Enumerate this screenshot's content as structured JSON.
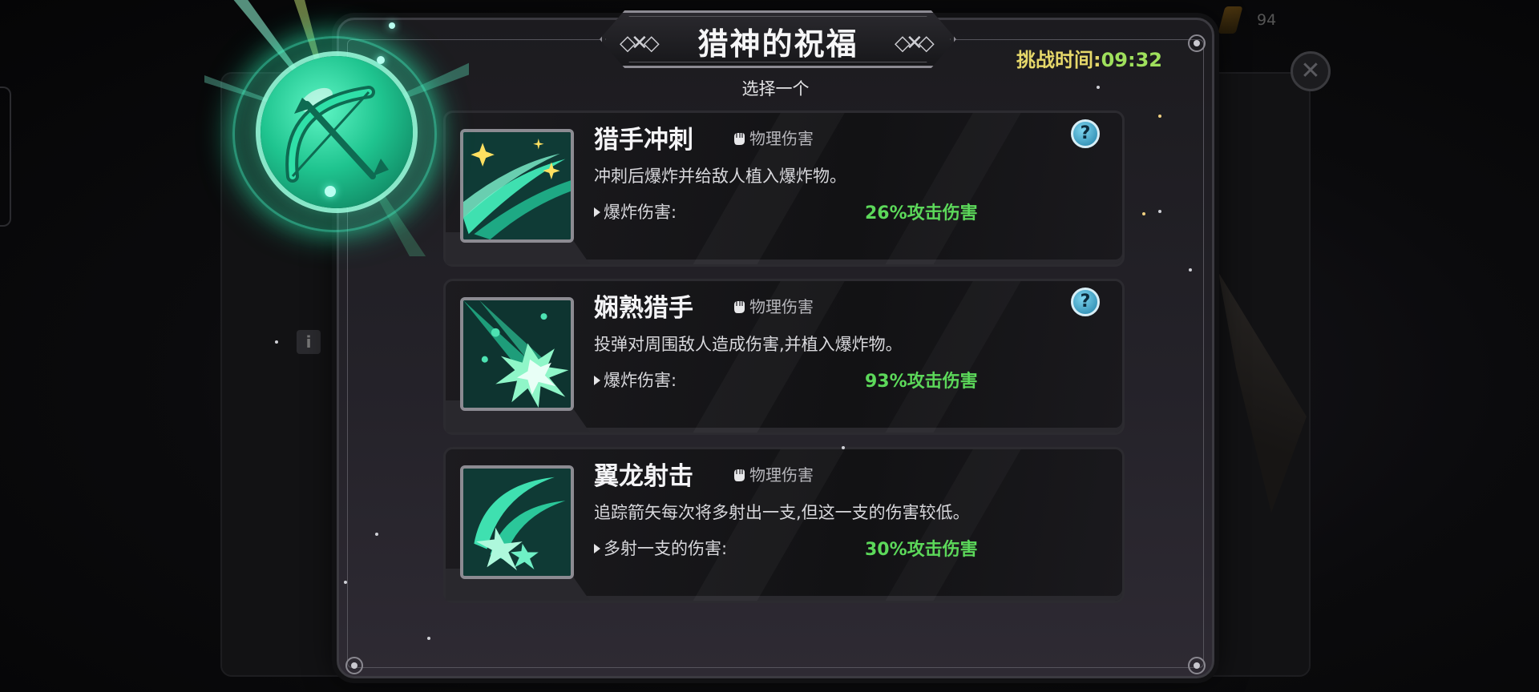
{
  "hud": {
    "counter": "94",
    "close_symbol": "✕",
    "info_symbol": "i"
  },
  "dialog": {
    "title": "猎神的祝福",
    "subtitle": "选择一个",
    "timer_label": "挑战时间:",
    "timer_value": "09:32"
  },
  "options": [
    {
      "name": "猎手冲刺",
      "damage_type": "物理伤害",
      "description": "冲刺后爆炸并给敌人植入爆炸物。",
      "stat_label": "爆炸伤害:",
      "stat_value": "26%攻击伤害",
      "icon": "dash-sparkle-icon",
      "help": "?"
    },
    {
      "name": "娴熟猎手",
      "damage_type": "物理伤害",
      "description": "投弹对周围敌人造成伤害,并植入爆炸物。",
      "stat_label": "爆炸伤害:",
      "stat_value": "93%攻击伤害",
      "icon": "burst-explosion-icon",
      "help": "?"
    },
    {
      "name": "翼龙射击",
      "damage_type": "物理伤害",
      "description": "追踪箭矢每次将多射出一支,但这一支的伤害较低。",
      "stat_label": "多射一支的伤害:",
      "stat_value": "30%攻击伤害",
      "icon": "curved-arrow-shot-icon"
    }
  ],
  "colors": {
    "accent_green": "#5cd85a",
    "timer_label": "#e6d86a",
    "orb_teal": "#1fc48f",
    "help_blue": "#1f7fa6"
  }
}
